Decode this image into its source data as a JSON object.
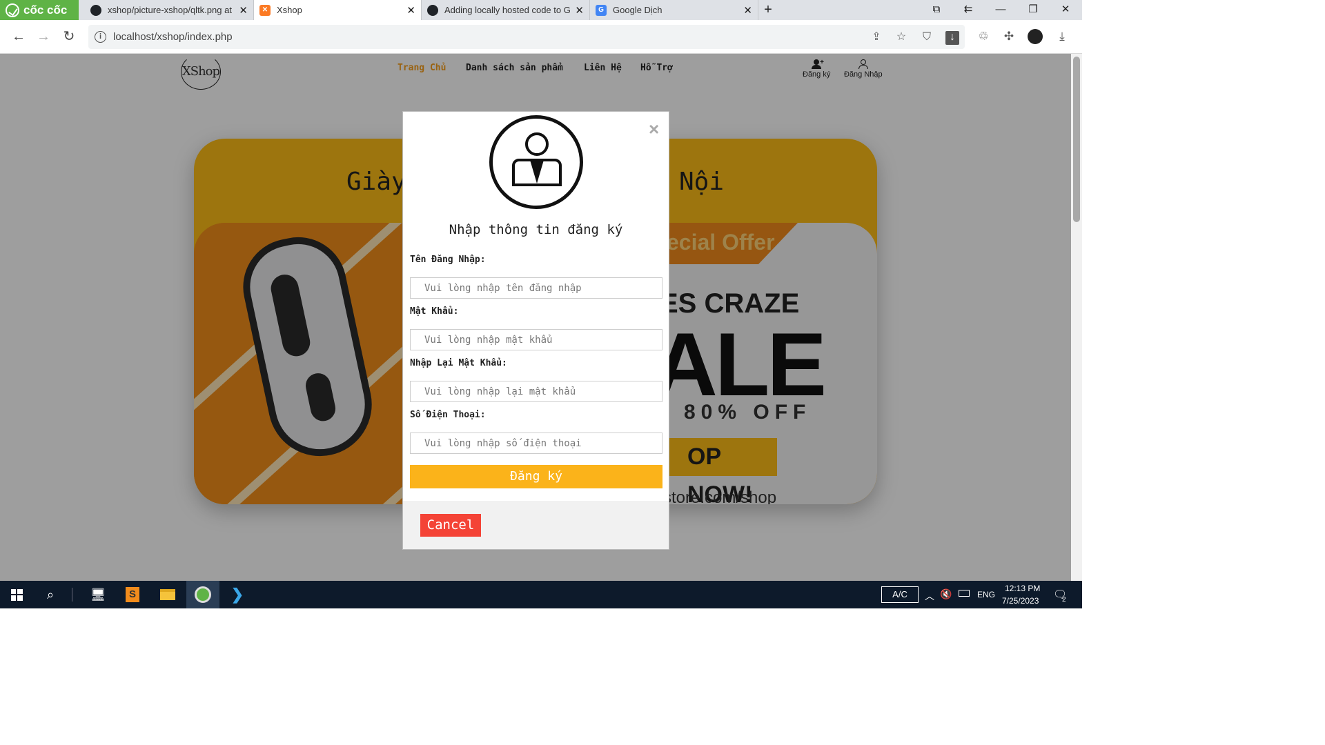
{
  "browser": {
    "brand": "cốc cốc",
    "tabs": [
      {
        "title": "xshop/picture-xshop/qltk.png at r",
        "icon": "github-icon"
      },
      {
        "title": "Xshop",
        "icon": "xampp-icon"
      },
      {
        "title": "Adding locally hosted code to Git",
        "icon": "github-icon"
      },
      {
        "title": "Google Dịch",
        "icon": "google-translate-icon"
      }
    ],
    "url": "localhost/xshop/index.php"
  },
  "site": {
    "logo": "XShop",
    "nav": [
      "Trang Chủ",
      "Danh sách sản phẩm",
      "Liên Hệ",
      "Hỗ Trợ"
    ],
    "register": "Đăng ký",
    "login": "Đăng Nhập",
    "hero_title_left": "Giày",
    "hero_title_right": "Nội",
    "banner": {
      "offer": "ecial Offer",
      "craze": "ES CRAZE",
      "sale": "ALE",
      "off": "80% OFF",
      "shop": "OP NOW!",
      "url": "store.com/shop"
    }
  },
  "modal": {
    "close": "×",
    "title": "Nhập thông tin đăng ký",
    "fields": [
      {
        "label": "Tên Đăng Nhập:",
        "placeholder": "Vui lòng nhập tên đăng nhập"
      },
      {
        "label": "Mật Khẩu:",
        "placeholder": "Vui lòng nhập mật khẩu"
      },
      {
        "label": "Nhập Lại Mật Khẩu:",
        "placeholder": "Vui lòng nhập lại mật khẩu"
      },
      {
        "label": "Số Điện Thoại:",
        "placeholder": "Vui lòng nhập số điện thoại"
      }
    ],
    "submit": "Đăng ký",
    "cancel": "Cancel"
  },
  "taskbar": {
    "ime": "A/C",
    "lang": "ENG",
    "time": "12:13 PM",
    "date": "7/25/2023",
    "notifications": "2"
  },
  "colors": {
    "accent": "#fbb31a",
    "cancel": "#f44336",
    "nav_active": "#f79e1b"
  }
}
